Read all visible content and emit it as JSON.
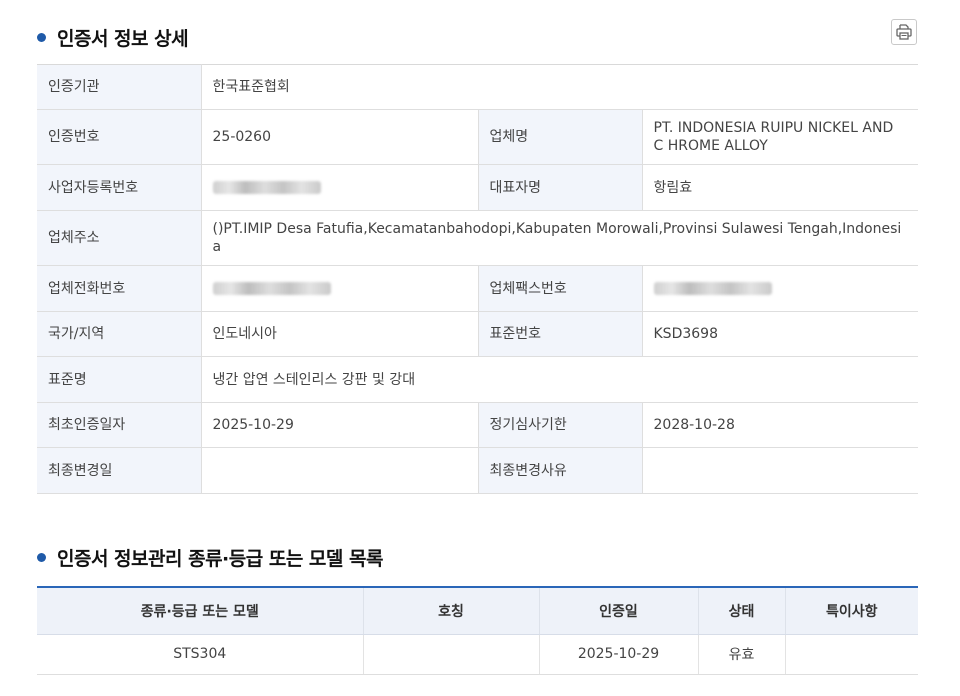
{
  "section1": {
    "title": "인증서 정보 상세"
  },
  "section2": {
    "title": "인증서 정보관리 종류·등급 또는 모델 목록"
  },
  "detail": {
    "cert_org_label": "인증기관",
    "cert_org_value": "한국표준협회",
    "cert_no_label": "인증번호",
    "cert_no_value": "25-0260",
    "company_label": "업체명",
    "company_value": "PT. INDONESIA RUIPU NICKEL AND C HROME ALLOY",
    "bizno_label": "사업자등록번호",
    "rep_label": "대표자명",
    "rep_value": "항림효",
    "addr_label": "업체주소",
    "addr_value": "()PT.IMIP Desa Fatufia,Kecamatanbahodopi,Kabupaten Morowali,Provinsi Sulawesi Tengah,Indonesia",
    "tel_label": "업체전화번호",
    "fax_label": "업체팩스번호",
    "country_label": "국가/지역",
    "country_value": "인도네시아",
    "stdno_label": "표준번호",
    "stdno_value": "KSD3698",
    "stdname_label": "표준명",
    "stdname_value": "냉간 압연 스테인리스 강판 및 강대",
    "first_date_label": "최초인증일자",
    "first_date_value": "2025-10-29",
    "review_label": "정기심사기한",
    "review_value": "2028-10-28",
    "last_change_label": "최종변경일",
    "last_change_value": "",
    "change_reason_label": "최종변경사유",
    "change_reason_value": ""
  },
  "models": {
    "headers": [
      "종류·등급 또는 모델",
      "호칭",
      "인증일",
      "상태",
      "특이사항"
    ],
    "rows": [
      {
        "model": "STS304",
        "name": "",
        "date": "2025-10-29",
        "status": "유효",
        "note": ""
      }
    ]
  },
  "icons": {
    "print": "print-icon"
  },
  "colors": {
    "accent": "#1f5aa8",
    "header_bg": "#f2f5fb",
    "list_border": "#2a66b8"
  }
}
